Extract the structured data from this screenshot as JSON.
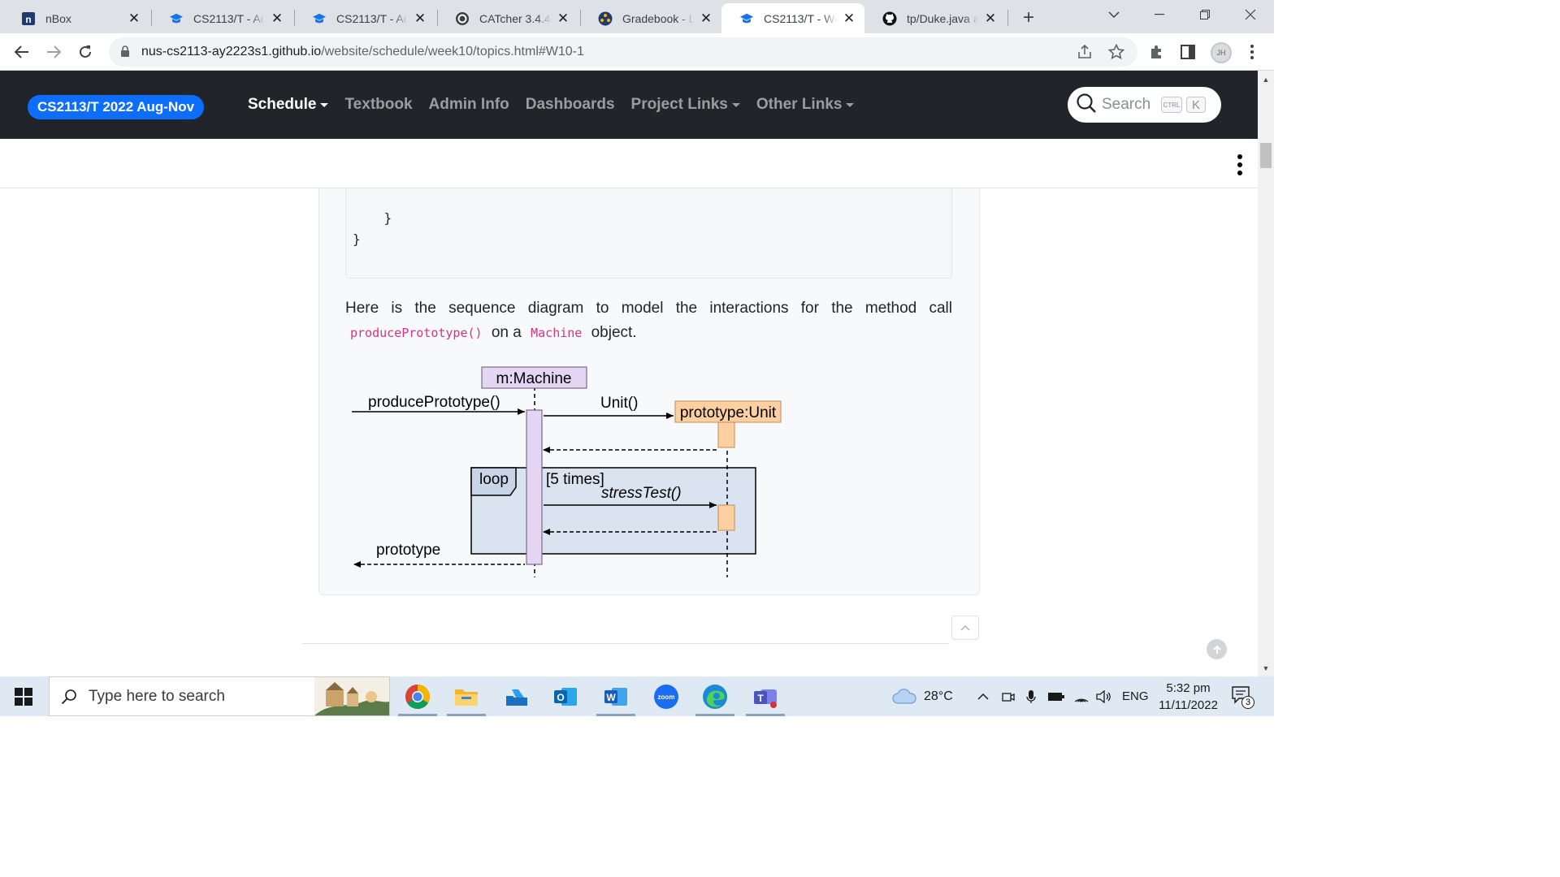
{
  "tabs": [
    {
      "title": "nBox",
      "icon": "nbox-icon",
      "active": false
    },
    {
      "title": "CS2113/T - Ad",
      "icon": "graduation-cap-icon",
      "active": false
    },
    {
      "title": "CS2113/T - Ad",
      "icon": "graduation-cap-icon",
      "active": false
    },
    {
      "title": "CATcher 3.4.4 -",
      "icon": "catcher-icon",
      "active": false
    },
    {
      "title": "Gradebook - Lu",
      "icon": "gradebook-icon",
      "active": false
    },
    {
      "title": "CS2113/T - We",
      "icon": "graduation-cap-icon",
      "active": true
    },
    {
      "title": "tp/Duke.java at",
      "icon": "github-icon",
      "active": false
    }
  ],
  "address_bar": {
    "host": "nus-cs2113-ay2223s1.github.io",
    "path": "/website/schedule/week10/topics.html#W10-1"
  },
  "profile_initials": "JH",
  "site_nav": {
    "brand": "CS2113/T 2022 Aug-Nov",
    "links": [
      {
        "label": "Schedule",
        "dropdown": true,
        "active": true
      },
      {
        "label": "Textbook",
        "dropdown": false,
        "active": false
      },
      {
        "label": "Admin Info",
        "dropdown": false,
        "active": false
      },
      {
        "label": "Dashboards",
        "dropdown": false,
        "active": false
      },
      {
        "label": "Project Links",
        "dropdown": true,
        "active": false
      },
      {
        "label": "Other Links",
        "dropdown": true,
        "active": false
      }
    ],
    "search_placeholder": "Search",
    "search_shortcut": [
      "CTRL",
      "K"
    ]
  },
  "code_lines": [
    "    }",
    "}"
  ],
  "paragraph": {
    "before": "Here is the sequence diagram to model the interactions for the method call",
    "code1": "producePrototype()",
    "mid": "on a",
    "code2": "Machine",
    "after": "object."
  },
  "diagram": {
    "machine_label": "m:Machine",
    "unit_label": "prototype:Unit",
    "call_label": "producePrototype()",
    "create_label": "Unit()",
    "loop_label": "loop",
    "loop_guard": "[5 times]",
    "loop_call": "stressTest()",
    "return_label": "prototype",
    "colors": {
      "machine_fill": "#e4d5f3",
      "unit_fill": "#fdd0a2",
      "loop_fill": "#dae3f0"
    }
  },
  "taskbar": {
    "search_placeholder": "Type here to search",
    "apps": [
      "chrome-icon",
      "file-explorer-icon",
      "onedrive-icon",
      "outlook-icon",
      "word-icon",
      "zoom-icon",
      "edge-icon",
      "teams-icon"
    ],
    "weather": "28°C",
    "language": "ENG",
    "time": "5:32 pm",
    "date": "11/11/2022",
    "notification_count": "3"
  }
}
